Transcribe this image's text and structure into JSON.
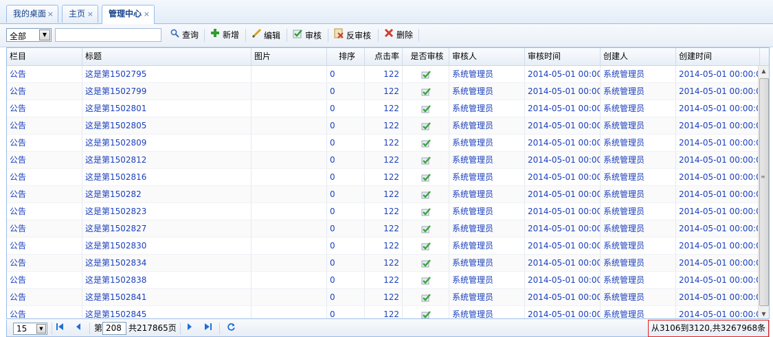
{
  "tabs": [
    {
      "label": "我的桌面",
      "close": "×"
    },
    {
      "label": "主页",
      "close": "×"
    },
    {
      "label": "管理中心",
      "close": "×"
    }
  ],
  "toolbar": {
    "filter_value": "全部",
    "search_value": "",
    "query_label": "查询",
    "add_label": "新增",
    "edit_label": "编辑",
    "audit_label": "审核",
    "unaudit_label": "反审核",
    "delete_label": "删除"
  },
  "grid": {
    "columns": [
      "栏目",
      "标题",
      "图片",
      "排序",
      "点击率",
      "是否审核",
      "审核人",
      "审核时间",
      "创建人",
      "创建时间"
    ],
    "rows": [
      [
        "公告",
        "这是第1502795",
        "",
        "0",
        "122",
        "系统管理员",
        "2014-05-01 00:00:",
        "系统管理员",
        "2014-05-01 00:00:0"
      ],
      [
        "公告",
        "这是第1502799",
        "",
        "0",
        "122",
        "系统管理员",
        "2014-05-01 00:00:",
        "系统管理员",
        "2014-05-01 00:00:0"
      ],
      [
        "公告",
        "这是第1502801",
        "",
        "0",
        "122",
        "系统管理员",
        "2014-05-01 00:00:",
        "系统管理员",
        "2014-05-01 00:00:0"
      ],
      [
        "公告",
        "这是第1502805",
        "",
        "0",
        "122",
        "系统管理员",
        "2014-05-01 00:00:",
        "系统管理员",
        "2014-05-01 00:00:0"
      ],
      [
        "公告",
        "这是第1502809",
        "",
        "0",
        "122",
        "系统管理员",
        "2014-05-01 00:00:",
        "系统管理员",
        "2014-05-01 00:00:0"
      ],
      [
        "公告",
        "这是第1502812",
        "",
        "0",
        "122",
        "系统管理员",
        "2014-05-01 00:00:",
        "系统管理员",
        "2014-05-01 00:00:0"
      ],
      [
        "公告",
        "这是第1502816",
        "",
        "0",
        "122",
        "系统管理员",
        "2014-05-01 00:00:",
        "系统管理员",
        "2014-05-01 00:00:0"
      ],
      [
        "公告",
        "这是第150282",
        "",
        "0",
        "122",
        "系统管理员",
        "2014-05-01 00:00:",
        "系统管理员",
        "2014-05-01 00:00:0"
      ],
      [
        "公告",
        "这是第1502823",
        "",
        "0",
        "122",
        "系统管理员",
        "2014-05-01 00:00:",
        "系统管理员",
        "2014-05-01 00:00:0"
      ],
      [
        "公告",
        "这是第1502827",
        "",
        "0",
        "122",
        "系统管理员",
        "2014-05-01 00:00:",
        "系统管理员",
        "2014-05-01 00:00:0"
      ],
      [
        "公告",
        "这是第1502830",
        "",
        "0",
        "122",
        "系统管理员",
        "2014-05-01 00:00:",
        "系统管理员",
        "2014-05-01 00:00:0"
      ],
      [
        "公告",
        "这是第1502834",
        "",
        "0",
        "122",
        "系统管理员",
        "2014-05-01 00:00:",
        "系统管理员",
        "2014-05-01 00:00:0"
      ],
      [
        "公告",
        "这是第1502838",
        "",
        "0",
        "122",
        "系统管理员",
        "2014-05-01 00:00:",
        "系统管理员",
        "2014-05-01 00:00:0"
      ],
      [
        "公告",
        "这是第1502841",
        "",
        "0",
        "122",
        "系统管理员",
        "2014-05-01 00:00:",
        "系统管理员",
        "2014-05-01 00:00:0"
      ],
      [
        "公告",
        "这是第1502845",
        "",
        "0",
        "122",
        "系统管理员",
        "2014-05-01 00:00:",
        "系统管理员",
        "2014-05-01 00:00:0"
      ]
    ]
  },
  "pager": {
    "page_size": "15",
    "page_prefix": "第",
    "current_page": "208",
    "total_pages_text": "共217865页",
    "info": "从3106到3120,共3267968条"
  },
  "colors": {
    "link": "#1a3fbd",
    "border": "#99bbe8",
    "check": "#3aa63a"
  }
}
